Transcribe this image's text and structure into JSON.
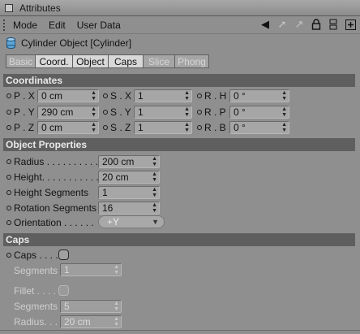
{
  "window": {
    "title": "Attributes"
  },
  "menu": {
    "items": [
      "Mode",
      "Edit",
      "User Data"
    ],
    "tools": [
      "arrow-left-icon",
      "arrow-right-icon",
      "arrow-up-icon",
      "lock-icon",
      "stack-icon",
      "add-panel-icon"
    ]
  },
  "object": {
    "title": "Cylinder Object [Cylinder]"
  },
  "tabs": [
    "Basic",
    "Coord.",
    "Object",
    "Caps",
    "Slice",
    "Phong"
  ],
  "tabs_active": [
    "Coord.",
    "Object",
    "Caps"
  ],
  "sections": {
    "coordinates": "Coordinates",
    "object_properties": "Object Properties",
    "caps": "Caps"
  },
  "coords": {
    "px_label": "P . X",
    "px_value": "0 cm",
    "py_label": "P . Y",
    "py_value": "290 cm",
    "pz_label": "P . Z",
    "pz_value": "0 cm",
    "sx_label": "S . X",
    "sx_value": "1",
    "sy_label": "S . Y",
    "sy_value": "1",
    "sz_label": "S . Z",
    "sz_value": "1",
    "rh_label": "R . H",
    "rh_value": "0 °",
    "rp_label": "R . P",
    "rp_value": "0 °",
    "rb_label": "R . B",
    "rb_value": "0 °"
  },
  "props": {
    "radius_label": "Radius . . . . . . . . . . .",
    "radius_value": "200 cm",
    "height_label": "Height. . . . . . . . . . . .",
    "height_value": "20 cm",
    "height_segments_label": "Height Segments",
    "height_segments_value": "1",
    "rotation_segments_label": "Rotation Segments",
    "rotation_segments_value": "16",
    "orientation_label": "Orientation . . . . . .",
    "orientation_value": "+Y"
  },
  "caps": {
    "caps_label": "Caps . . . .",
    "caps_checked": false,
    "segments_label": "Segments",
    "segments_value": "1",
    "fillet_label": "Fillet . . . .",
    "fillet_checked": false,
    "fillet_segments_label": "Segments",
    "fillet_segments_value": "5",
    "fillet_radius_label": "Radius. . .",
    "fillet_radius_value": "20 cm"
  },
  "colors": {
    "panel_bg": "#8f8f8f",
    "section_bg": "#5f5f5f",
    "active_tab": "#d8d8d8"
  }
}
